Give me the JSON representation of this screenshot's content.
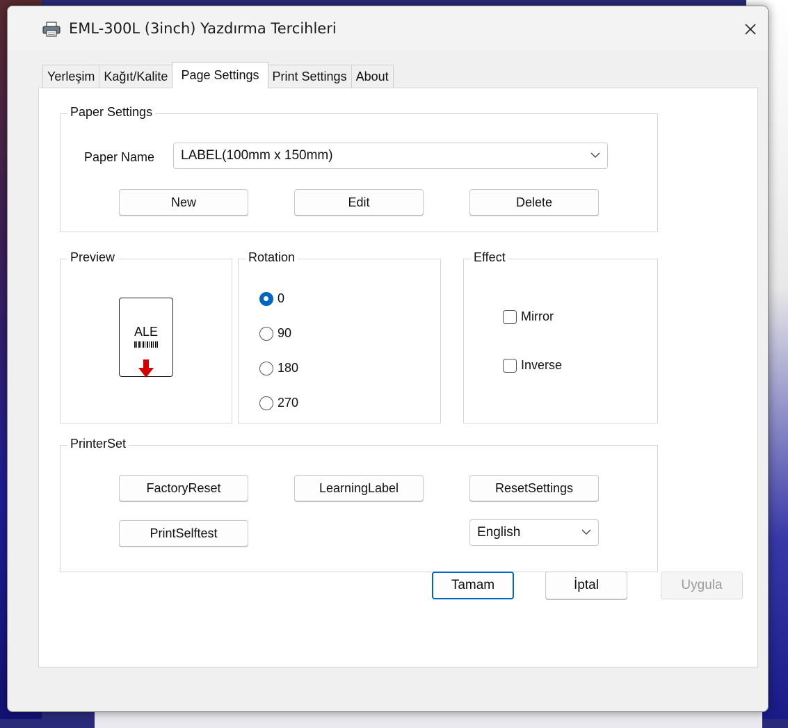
{
  "window": {
    "title": "EML-300L (3inch) Yazdırma Tercihleri",
    "icon": "printer-icon"
  },
  "tabs": [
    {
      "label": "Yerleşim",
      "active": false
    },
    {
      "label": "Kağıt/Kalite",
      "active": false
    },
    {
      "label": "Page Settings",
      "active": true
    },
    {
      "label": "Print Settings",
      "active": false
    },
    {
      "label": "About",
      "active": false
    }
  ],
  "paper_settings": {
    "title": "Paper Settings",
    "paper_name_label": "Paper Name",
    "paper_name_value": "LABEL(100mm x 150mm)",
    "buttons": {
      "new": "New",
      "edit": "Edit",
      "delete": "Delete"
    }
  },
  "preview": {
    "title": "Preview",
    "sample_text": "ALE",
    "arrow_color": "#d40000"
  },
  "rotation": {
    "title": "Rotation",
    "options": [
      "0",
      "90",
      "180",
      "270"
    ],
    "selected": "0"
  },
  "effect": {
    "title": "Effect",
    "mirror_label": "Mirror",
    "mirror_checked": false,
    "inverse_label": "Inverse",
    "inverse_checked": false
  },
  "printer_set": {
    "title": "PrinterSet",
    "factory_reset": "FactoryReset",
    "learning_label": "LearningLabel",
    "reset_settings": "ResetSettings",
    "print_selftest": "PrintSelftest",
    "language_value": "English"
  },
  "footer": {
    "ok": "Tamam",
    "cancel": "İptal",
    "apply": "Uygula"
  },
  "colors": {
    "accent": "#0067c0",
    "disabled_text": "#9a9a9a"
  }
}
